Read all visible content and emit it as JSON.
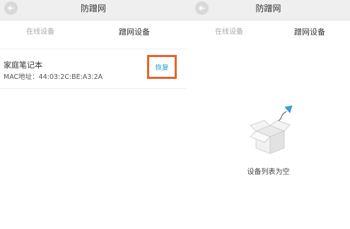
{
  "left_screen": {
    "title": "防蹭网",
    "tabs": [
      {
        "label": "在线设备",
        "active": false
      },
      {
        "label": "蹭网设备",
        "active": true
      }
    ],
    "device": {
      "name": "家庭笔记本",
      "mac": "MAC地址：44:03:2C:BE:A3:2A",
      "action_label": "恢复"
    }
  },
  "right_screen": {
    "title": "防蹭网",
    "tabs": [
      {
        "label": "在线设备",
        "active": false
      },
      {
        "label": "蹭网设备",
        "active": true
      }
    ],
    "empty_state": {
      "message": "设备列表为空",
      "icon": "empty-box-icon"
    }
  },
  "colors": {
    "header_bg": "#efefef",
    "highlight_border": "#e8622b",
    "link_blue": "#1a9ad6",
    "inactive_tab": "#a9a9a9"
  }
}
